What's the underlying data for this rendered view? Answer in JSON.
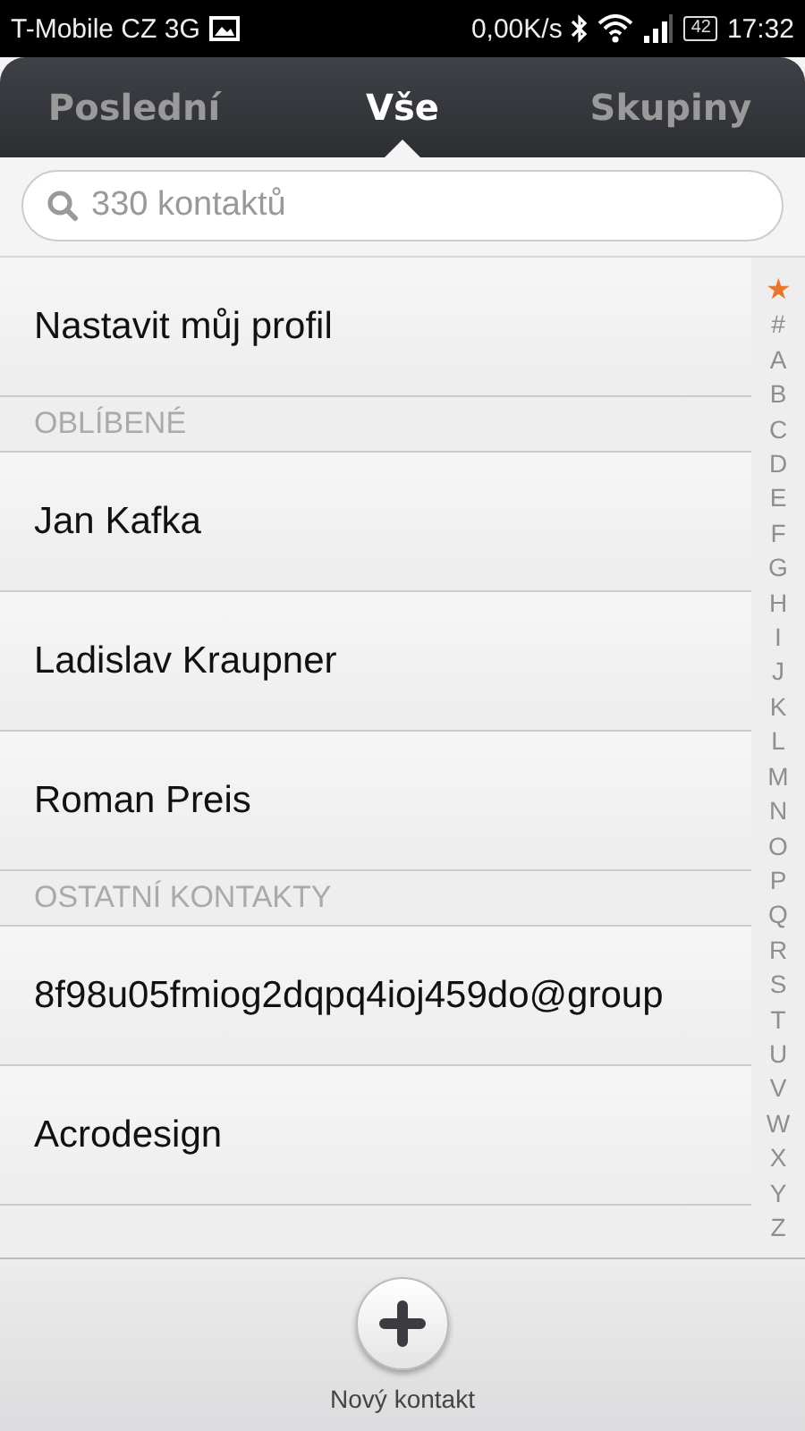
{
  "status_bar": {
    "carrier": "T-Mobile CZ 3G",
    "speed": "0,00K/s",
    "battery": "42",
    "time": "17:32"
  },
  "tabs": [
    {
      "label": "Poslední",
      "selected": false
    },
    {
      "label": "Vše",
      "selected": true
    },
    {
      "label": "Skupiny",
      "selected": false
    }
  ],
  "search": {
    "placeholder": "330 kontaktů"
  },
  "list": [
    {
      "kind": "row",
      "text": "Nastavit můj profil"
    },
    {
      "kind": "header",
      "text": "OBLÍBENÉ"
    },
    {
      "kind": "row",
      "text": "Jan Kafka"
    },
    {
      "kind": "row",
      "text": "Ladislav Kraupner"
    },
    {
      "kind": "row",
      "text": "Roman Preis"
    },
    {
      "kind": "header",
      "text": "OSTATNÍ KONTAKTY"
    },
    {
      "kind": "row",
      "text": "8f98u05fmiog2dqpq4ioj459do@group"
    },
    {
      "kind": "row",
      "text": "Acrodesign"
    }
  ],
  "index": [
    {
      "text": "★",
      "kind": "star"
    },
    {
      "text": "#"
    },
    {
      "text": "A"
    },
    {
      "text": "B"
    },
    {
      "text": "C"
    },
    {
      "text": "D"
    },
    {
      "text": "E"
    },
    {
      "text": "F"
    },
    {
      "text": "G"
    },
    {
      "text": "H"
    },
    {
      "text": "I"
    },
    {
      "text": "J"
    },
    {
      "text": "K"
    },
    {
      "text": "L"
    },
    {
      "text": "M"
    },
    {
      "text": "N"
    },
    {
      "text": "O"
    },
    {
      "text": "P"
    },
    {
      "text": "Q"
    },
    {
      "text": "R"
    },
    {
      "text": "S"
    },
    {
      "text": "T"
    },
    {
      "text": "U"
    },
    {
      "text": "V"
    },
    {
      "text": "W"
    },
    {
      "text": "X"
    },
    {
      "text": "Y"
    },
    {
      "text": "Z"
    }
  ],
  "new_contact": {
    "label": "Nový kontakt"
  }
}
